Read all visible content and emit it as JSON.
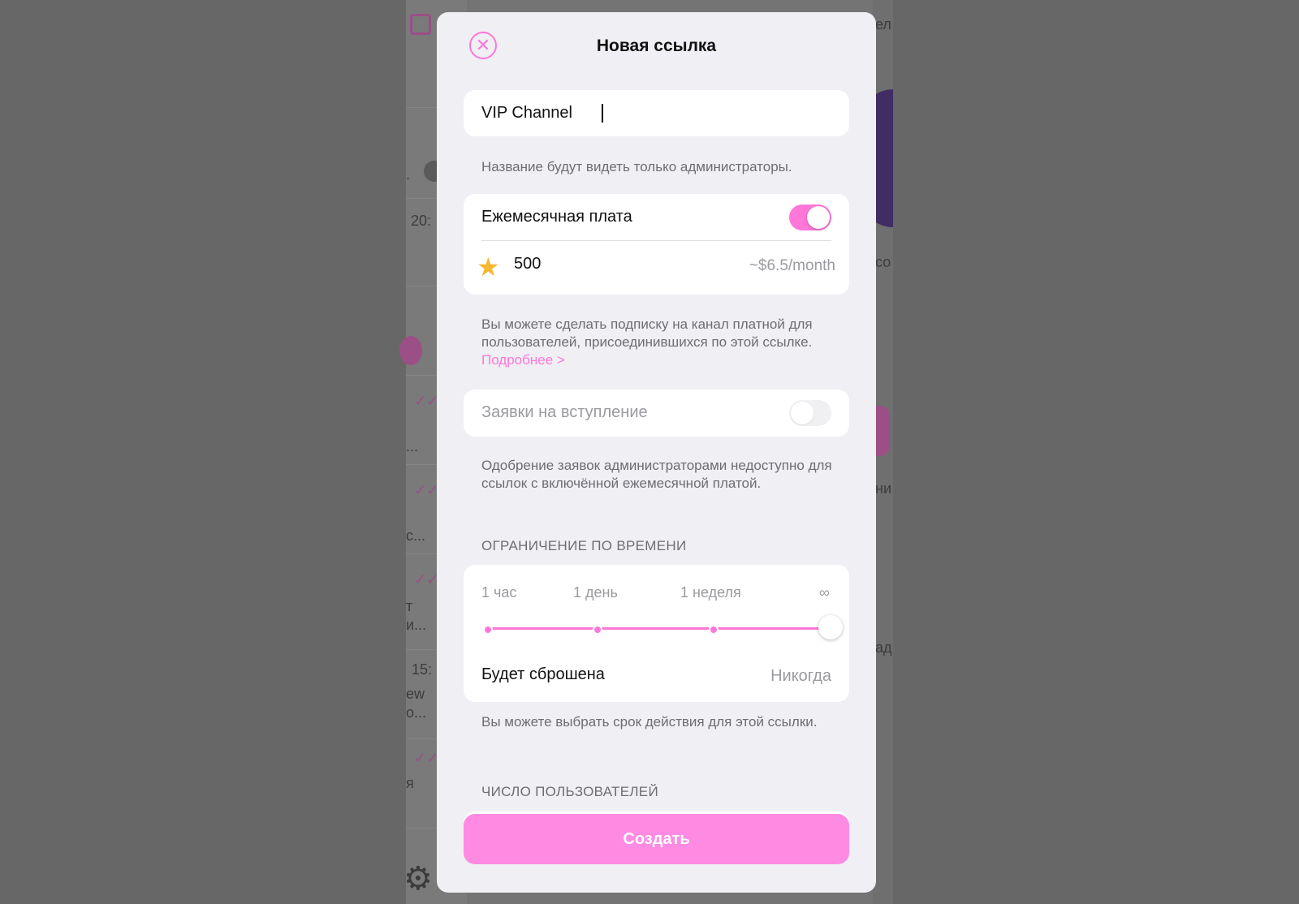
{
  "background": {
    "fragments": [
      "ел",
      "20:",
      "со",
      "ни",
      "ад",
      "...",
      "с...",
      "т",
      "и...",
      "15:",
      "ew",
      "о...",
      "я",
      "."
    ]
  },
  "modal": {
    "title": "Новая ссылка",
    "close_icon": "close-icon",
    "name_field": {
      "value": "VIP Channel",
      "hint": "Название будут видеть только администраторы."
    },
    "monthly_fee": {
      "label": "Ежемесячная плата",
      "enabled": true,
      "currency_icon": "star-icon",
      "price": "500",
      "usd_estimate": "~$6.5/month",
      "hint": "Вы можете сделать подписку на канал платной для пользователей, присоединившихся по этой ссылке.",
      "more_link": "Подробнее >"
    },
    "join_requests": {
      "label": "Заявки на вступление",
      "enabled": false,
      "hint": "Одобрение заявок администраторами недоступно для ссылок с включённой ежемесячной платой."
    },
    "time_limit": {
      "header": "ОГРАНИЧЕНИЕ ПО ВРЕМЕНИ",
      "ticks": [
        "1 час",
        "1 день",
        "1 неделя",
        "∞"
      ],
      "selected": "∞",
      "reset_label": "Будет сброшена",
      "reset_value": "Никогда",
      "hint": "Вы можете выбрать срок действия для этой ссылки."
    },
    "user_limit": {
      "header": "ЧИСЛО ПОЛЬЗОВАТЕЛЕЙ"
    },
    "create_button": "Создать"
  },
  "colors": {
    "accent": "#ff77d8",
    "button": "#ff8ae2",
    "star": "#f7b731"
  }
}
